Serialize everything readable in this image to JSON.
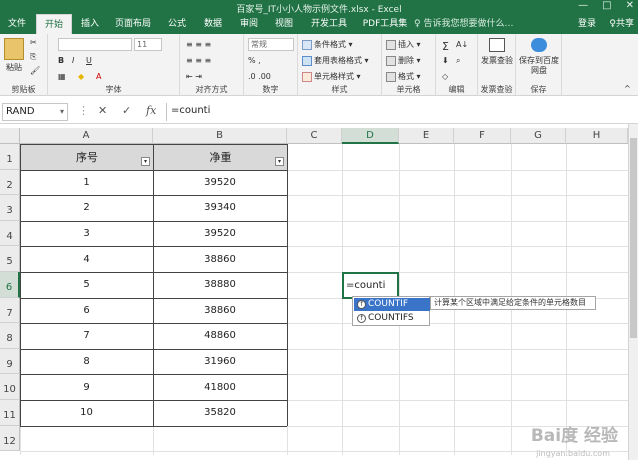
{
  "window": {
    "title": "百家号_IT小小人物示例文件.xlsx - Excel",
    "login": "登录",
    "share": "共享"
  },
  "tabs": [
    "文件",
    "开始",
    "插入",
    "页面布局",
    "公式",
    "数据",
    "审阅",
    "视图",
    "开发工具",
    "PDF工具集",
    "♀ 告诉我您想要做什么…"
  ],
  "ribbon": {
    "clipboard": {
      "paste": "粘贴",
      "label": "剪贴板"
    },
    "font": {
      "size": "11",
      "label": "字体"
    },
    "alignment": {
      "label": "对齐方式"
    },
    "number": {
      "format": "常规",
      "label": "数字"
    },
    "styles": {
      "conditional": "条件格式 ▾",
      "table": "套用表格格式 ▾",
      "cell": "单元格样式 ▾",
      "label": "样式"
    },
    "cells": {
      "insert": "插入 ▾",
      "delete": "删除 ▾",
      "format": "格式 ▾",
      "label": "单元格"
    },
    "editing": {
      "label": "编辑"
    },
    "invoice": {
      "button": "发票查验",
      "label": "发票查验"
    },
    "save": {
      "button": "保存到百度网盘",
      "label": "保存"
    }
  },
  "formula_bar": {
    "name_box": "RAND",
    "cancel": "✕",
    "enter": "✓",
    "fx": "fx",
    "formula": "=counti"
  },
  "grid": {
    "columns": [
      "A",
      "B",
      "C",
      "D",
      "E",
      "F",
      "G",
      "H"
    ],
    "rows": [
      "1",
      "2",
      "3",
      "4",
      "5",
      "6",
      "7",
      "8",
      "9",
      "10",
      "11",
      "12"
    ],
    "header": [
      "序号",
      "净重"
    ],
    "data": [
      [
        "1",
        "39520"
      ],
      [
        "2",
        "39340"
      ],
      [
        "3",
        "39520"
      ],
      [
        "4",
        "38860"
      ],
      [
        "5",
        "38880"
      ],
      [
        "6",
        "38860"
      ],
      [
        "7",
        "48860"
      ],
      [
        "8",
        "31960"
      ],
      [
        "9",
        "41800"
      ],
      [
        "10",
        "35820"
      ]
    ],
    "active_cell_text": "=counti"
  },
  "autocomplete": {
    "items": [
      "COUNTIF",
      "COUNTIFS"
    ],
    "tooltip": "计算某个区域中满足给定条件的单元格数目"
  },
  "watermark": {
    "text": "Bai度 经验",
    "sub": "jingyan.baidu.com"
  },
  "colors": {
    "excel_green": "#217346",
    "selection_blue": "#3a74c9"
  }
}
